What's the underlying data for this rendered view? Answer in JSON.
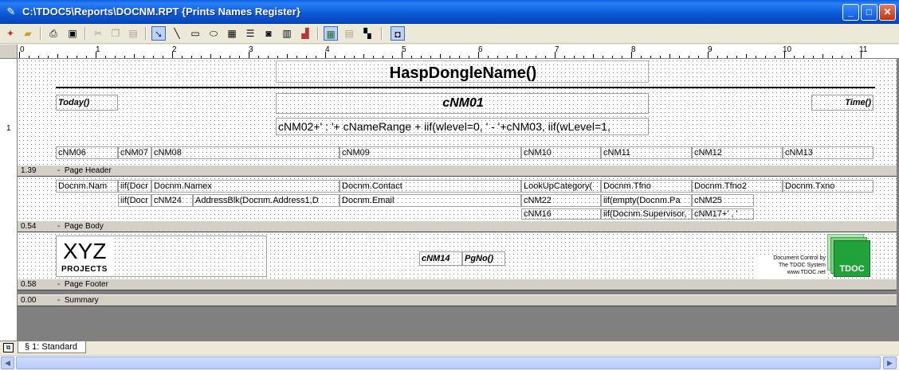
{
  "window": {
    "title": "C:\\TDOC5\\Reports\\DOCNM.RPT {Prints Names Register}",
    "minimize": "_",
    "maximize": "□",
    "close": "✕"
  },
  "toolbar": {
    "icons": [
      "new-report-icon",
      "open-folder-icon",
      "print-icon",
      "print-preview-icon",
      "cut-icon",
      "copy-icon",
      "paste-icon",
      "pointer-tool-icon",
      "line-tool-icon",
      "rectangle-tool-icon",
      "ellipse-tool-icon",
      "field-tool-icon",
      "text-tool-icon",
      "picture-tool-icon",
      "table-tool-icon",
      "chart-tool-icon",
      "grid-icon",
      "properties-icon",
      "layout-icon",
      "page-icon"
    ]
  },
  "ruler": {
    "h": [
      "0",
      "1",
      "2",
      "3",
      "4",
      "5",
      "6",
      "7",
      "8",
      "9",
      "10",
      "11"
    ],
    "v": [
      "1"
    ]
  },
  "report": {
    "header": {
      "title_expr": "HaspDongleName()",
      "today": "Today()",
      "company_field": "cNM01",
      "range_expr": "cNM02+' : '+ cNameRange + iif(wlevel=0, ' - '+cNM03, iif(wLevel=1,",
      "time": "Time()",
      "columns": [
        "cNM06",
        "cNM07",
        "cNM08",
        "cNM09",
        "cNM10",
        "cNM11",
        "cNM12",
        "cNM13"
      ]
    },
    "header_sep": {
      "height": "1.39",
      "label": "Page Header"
    },
    "body": {
      "row1": [
        "Docnm.Nam",
        "iif(Docr",
        "Docnm.Namex",
        "Docnm.Contact",
        "LookUpCategory(",
        "Docnm.Tfno",
        "Docnm.Tfno2",
        "Docnm.Txno"
      ],
      "row2": [
        "iif(Docr",
        "cNM24",
        "AddressBlk(Docnm.Address1,D",
        "Docnm.Email",
        "cNM22",
        "iif(empty(Docnm.Pa",
        "cNM25"
      ],
      "row3": [
        "cNM16",
        "iif(Docnm.Supervisor,",
        "cNM17+' , '"
      ]
    },
    "body_sep": {
      "height": "0.54",
      "label": "Page Body"
    },
    "footer": {
      "logo_main": "XYZ",
      "logo_sub": "PROJECTS",
      "page_field": "cNM14",
      "page_no": "PgNo()",
      "control_lines": [
        "Document Control by",
        "The TDOC System",
        "www.TDOC.net"
      ],
      "tdoc_logo": "TDOC"
    },
    "footer_sep": {
      "height": "0.58",
      "label": "Page Footer"
    },
    "summary_sep": {
      "height": "0.00",
      "label": "Summary"
    }
  },
  "tabs": [
    {
      "label": "§ 1: Standard"
    }
  ],
  "scrollbar": {
    "left": "◀",
    "right": "▶"
  }
}
